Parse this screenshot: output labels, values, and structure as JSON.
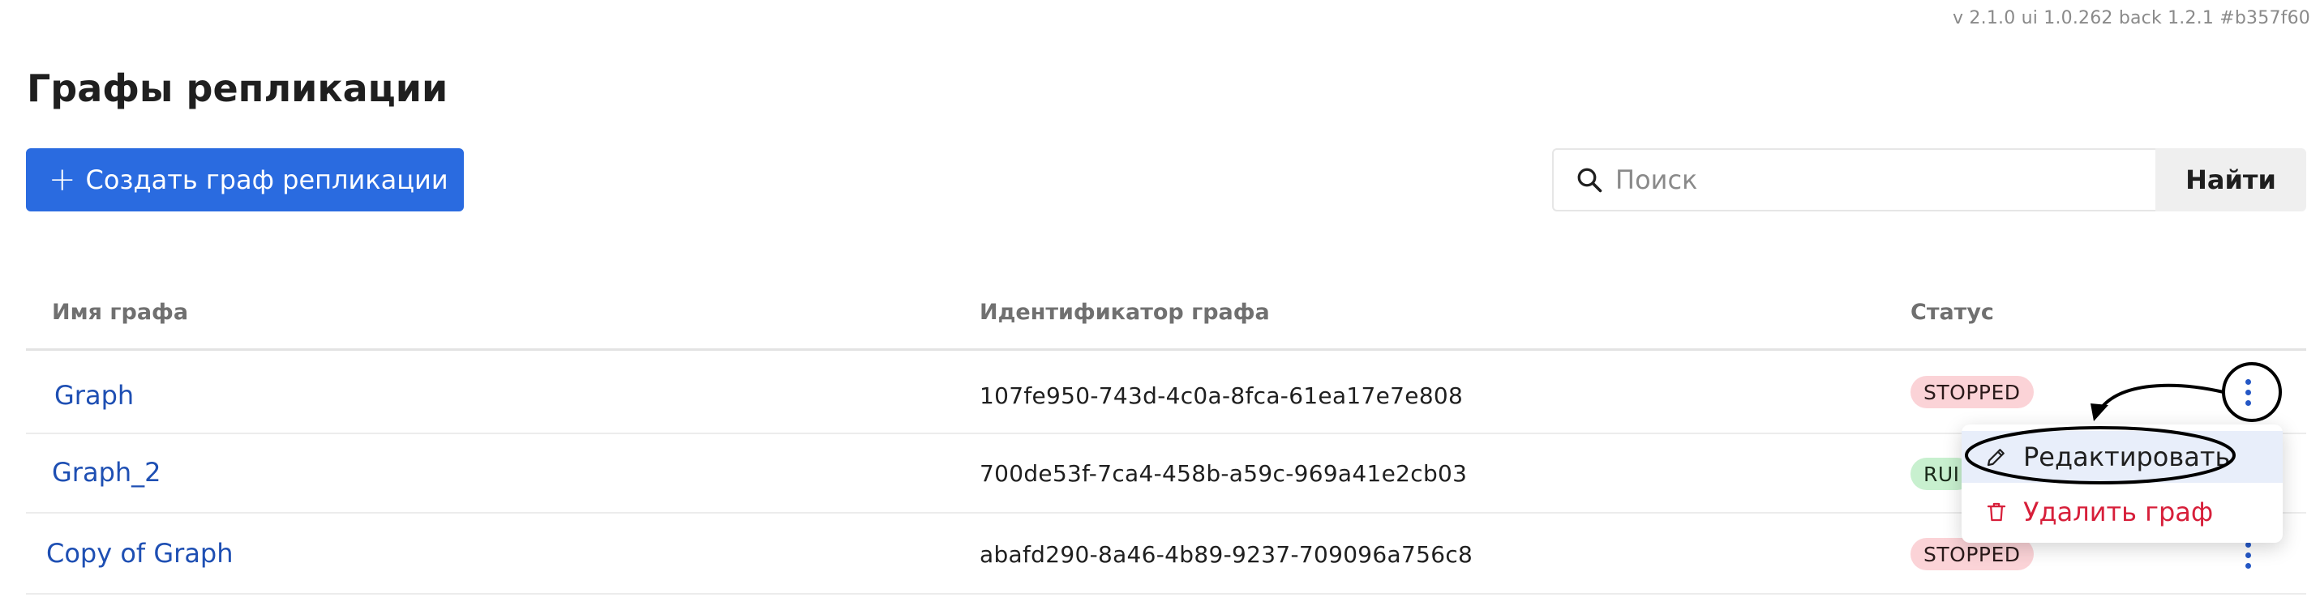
{
  "version_info": "v 2.1.0  ui 1.0.262  back 1.2.1  #b357f60",
  "page": {
    "title": "Графы репликации",
    "create_button_label": "Создать граф репликации"
  },
  "search": {
    "placeholder": "Поиск",
    "value": "",
    "submit_label": "Найти"
  },
  "table": {
    "columns": [
      "Имя графа",
      "Идентификатор графа",
      "Статус"
    ],
    "rows": [
      {
        "name": "Graph",
        "id": "107fe950-743d-4c0a-8fca-61ea17e7e808",
        "status": "STOPPED"
      },
      {
        "name": "Graph_2",
        "id": "700de53f-7ca4-458b-a59c-969a41e2cb03",
        "status": "RUI"
      },
      {
        "name": "Copy of Graph",
        "id": "abafd290-8a46-4b89-9237-709096a756c8",
        "status": "STOPPED"
      }
    ]
  },
  "context_menu": {
    "edit_label": "Редактировать",
    "delete_label": "Удалить граф"
  },
  "colors": {
    "primary": "#2a6be0",
    "link": "#1e4fb3",
    "stopped_bg": "#fbd3d7",
    "running_bg": "#c8f0cf",
    "danger": "#d71f3a",
    "menu_highlight": "#e8eefa"
  },
  "icons": {
    "create": "plus-icon",
    "search": "magnifier-icon",
    "row_actions": "kebab-vertical-icon",
    "edit": "pencil-icon",
    "delete": "trash-icon"
  }
}
